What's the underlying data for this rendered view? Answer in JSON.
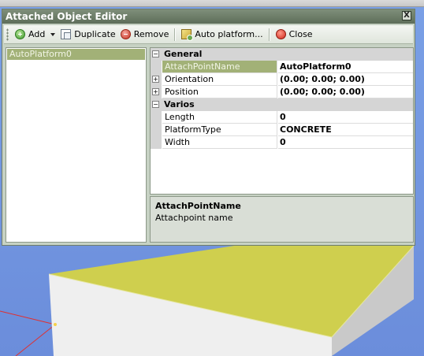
{
  "window": {
    "title": "Attached Object Editor",
    "close_glyph": "X"
  },
  "toolbar": {
    "add_label": "Add",
    "duplicate_label": "Duplicate",
    "remove_label": "Remove",
    "auto_platform_label": "Auto platform...",
    "close_label": "Close"
  },
  "object_list": {
    "items": [
      "AutoPlatform0"
    ],
    "selected_index": 0
  },
  "property_grid": {
    "categories": [
      {
        "name": "General",
        "expanded": true,
        "glyph": "⊟",
        "properties": [
          {
            "name": "AttachPointName",
            "value": "AutoPlatform0",
            "selected": true
          },
          {
            "name": "Orientation",
            "value": "(0.00; 0.00; 0.00)",
            "expandable": true,
            "glyph": "+"
          },
          {
            "name": "Position",
            "value": "(0.00; 0.00; 0.00)",
            "expandable": true,
            "glyph": "+"
          }
        ]
      },
      {
        "name": "Varios",
        "expanded": true,
        "glyph": "⊟",
        "properties": [
          {
            "name": "Length",
            "value": "0"
          },
          {
            "name": "PlatformType",
            "value": "CONCRETE"
          },
          {
            "name": "Width",
            "value": "0"
          }
        ]
      }
    ]
  },
  "description": {
    "title": "AttachPointName",
    "text": "Attachpoint name"
  },
  "colors": {
    "selection": "#a2b177",
    "viewport_sky": "#6b8fd6",
    "platform_top": "#cfcf4e",
    "platform_side": "#ececec",
    "axis_line": "#e03030"
  },
  "icons": {
    "add": "add-icon",
    "duplicate": "duplicate-icon",
    "remove": "remove-icon",
    "auto_platform": "auto-platform-icon",
    "close": "close-icon"
  }
}
